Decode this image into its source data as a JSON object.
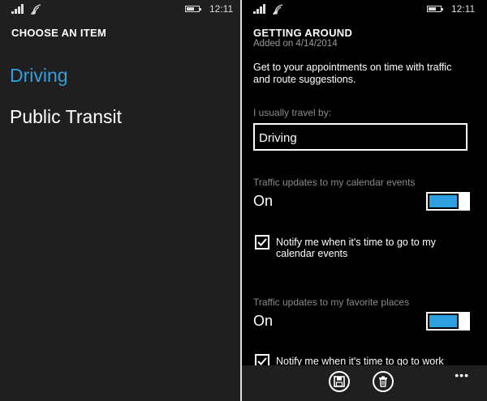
{
  "status_left": {
    "time": "12:11",
    "signal_icon": "signal-icon",
    "wifi_icon": "wifi-icon",
    "battery_icon": "battery-icon",
    "battery_level": 0.6
  },
  "status_right": {
    "time": "12:11",
    "battery_level": 0.6
  },
  "picker": {
    "header": "CHOOSE AN ITEM",
    "options": [
      {
        "label": "Driving",
        "selected": true
      },
      {
        "label": "Public Transit",
        "selected": false
      }
    ],
    "accent": "#2ea0e0"
  },
  "settings": {
    "title": "GETTING AROUND",
    "added": "Added on 4/14/2014",
    "description": "Get to your appointments on time with traffic and route suggestions.",
    "travel_label": "I usually travel by:",
    "travel_value": "Driving",
    "calendar_label": "Traffic updates to my calendar events",
    "calendar_state": "On",
    "calendar_notify": "Notify me when it's time to go to my calendar events",
    "calendar_notify_checked": true,
    "places_label": "Traffic updates to my favorite places",
    "places_state": "On",
    "places_notify": "Notify me when it's time to go to work",
    "places_notify_checked": true
  },
  "appbar": {
    "save_icon": "save-icon",
    "delete_icon": "delete-icon",
    "more": "•••"
  }
}
